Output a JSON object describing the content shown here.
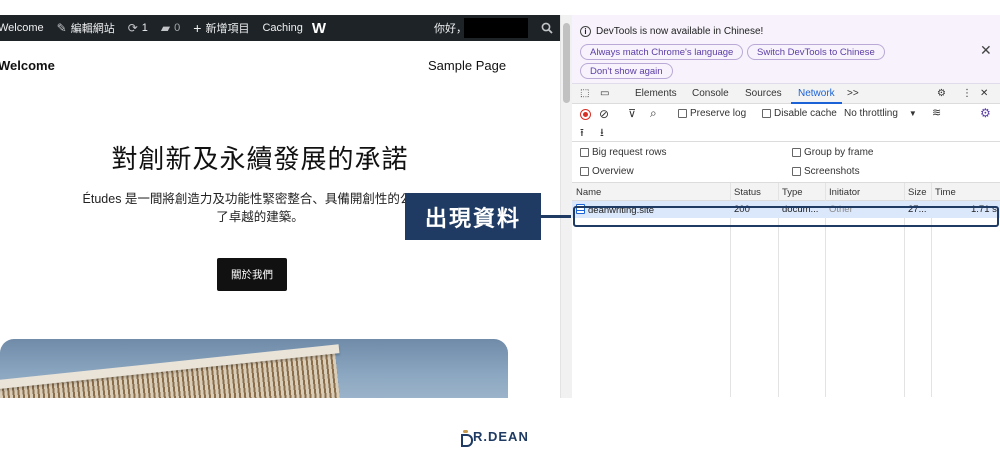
{
  "site": {
    "adminbar": {
      "welcome": "Welcome",
      "edit_site": "編輯網站",
      "updates_count": "1",
      "comments_count": "0",
      "new_item": "新增項目",
      "caching": "Caching",
      "logo": "W",
      "greeting": "你好，"
    },
    "header": {
      "site_title": "Welcome",
      "nav_item": "Sample Page"
    },
    "hero": {
      "heading": "對創新及永續發展的承諾",
      "text_line1": "Études 是一間將創造力及功能性緊密整合、具備開創性的公司，",
      "text_line2": "了卓越的建築。",
      "button_label": "關於我們"
    }
  },
  "devtools": {
    "banner": {
      "message": "DevTools is now available in Chinese!",
      "match_language": "Always match Chrome's language",
      "switch_chinese": "Switch DevTools to Chinese",
      "dont_show": "Don't show again"
    },
    "tabs": {
      "elements": "Elements",
      "console": "Console",
      "sources": "Sources",
      "network": "Network",
      "more": ">>"
    },
    "toolbar": {
      "preserve_log": "Preserve log",
      "disable_cache": "Disable cache",
      "throttling": "No throttling"
    },
    "options": {
      "big_request_rows": "Big request rows",
      "group_by_frame": "Group by frame",
      "overview": "Overview",
      "screenshots": "Screenshots"
    },
    "table": {
      "columns": [
        "Name",
        "Status",
        "Type",
        "Initiator",
        "Size",
        "Time"
      ],
      "rows": [
        {
          "name": "deanwriting.site",
          "status": "200",
          "type": "docum...",
          "initiator": "Other",
          "size": "27...",
          "time": "1.71 s"
        }
      ]
    }
  },
  "annotation": {
    "label": "出現資料",
    "color": "#1f3b63"
  },
  "brand": {
    "name": "R.DEAN"
  },
  "colors": {
    "adminbar_bg": "#1d2327",
    "devtools_accent": "#1a62d6",
    "selected_row_bg": "#dbe7fb",
    "record_red": "#d93025"
  }
}
